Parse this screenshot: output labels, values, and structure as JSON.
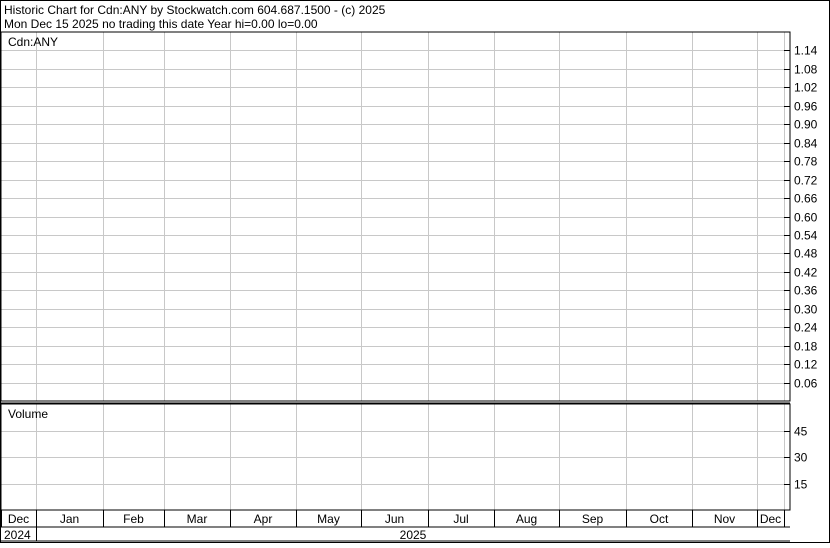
{
  "header": {
    "line1": "Historic Chart for Cdn:ANY by Stockwatch.com 604.687.1500 - (c) 2025",
    "line2": "Mon Dec 15 2025   no trading this date  Year hi=0.00  lo=0.00"
  },
  "price_panel": {
    "label": "Cdn:ANY"
  },
  "volume_panel": {
    "label": "Volume"
  },
  "chart_data": [
    {
      "type": "line",
      "title": "Cdn:ANY",
      "series": [],
      "x": [
        "Dec",
        "Jan",
        "Feb",
        "Mar",
        "Apr",
        "May",
        "Jun",
        "Jul",
        "Aug",
        "Sep",
        "Oct",
        "Nov",
        "Dec"
      ],
      "year_labels": [
        "2024",
        "2025"
      ],
      "y_ticks": [
        "1.14",
        "1.08",
        "1.02",
        "0.96",
        "0.90",
        "0.84",
        "0.78",
        "0.72",
        "0.66",
        "0.60",
        "0.54",
        "0.48",
        "0.42",
        "0.36",
        "0.30",
        "0.24",
        "0.18",
        "0.12",
        "0.06"
      ],
      "y_tick_values": [
        1.14,
        1.08,
        1.02,
        0.96,
        0.9,
        0.84,
        0.78,
        0.72,
        0.66,
        0.6,
        0.54,
        0.48,
        0.42,
        0.36,
        0.3,
        0.24,
        0.18,
        0.12,
        0.06
      ],
      "ylim": [
        0.0,
        1.2
      ],
      "grid": true
    },
    {
      "type": "bar",
      "title": "Volume",
      "series": [],
      "x": [
        "Dec",
        "Jan",
        "Feb",
        "Mar",
        "Apr",
        "May",
        "Jun",
        "Jul",
        "Aug",
        "Sep",
        "Oct",
        "Nov",
        "Dec"
      ],
      "y_ticks": [
        "45",
        "30",
        "15"
      ],
      "y_tick_values": [
        45,
        30,
        15
      ],
      "ylim": [
        0,
        60
      ],
      "grid": true
    }
  ]
}
